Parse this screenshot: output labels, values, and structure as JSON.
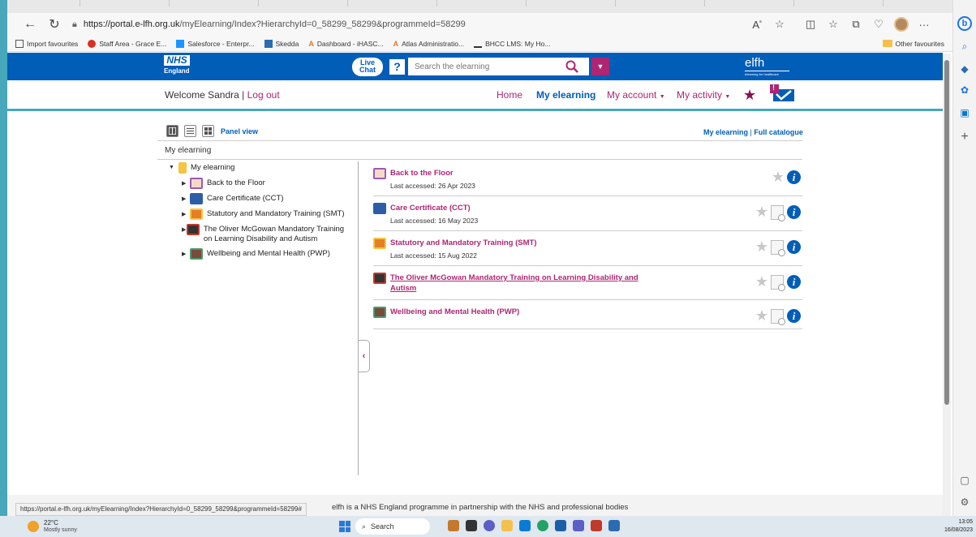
{
  "browser": {
    "url_host": "https://portal.e-lfh.org.uk",
    "url_path": "/myElearning/Index?HierarchyId=0_58299_58299&programmeId=58299",
    "favourites": [
      {
        "label": "Import favourites",
        "color": "#555555"
      },
      {
        "label": "Staff Area - Grace E...",
        "color": "#d93025"
      },
      {
        "label": "Salesforce - Enterpr...",
        "color": "#1b96ff"
      },
      {
        "label": "Skedda",
        "color": "#2b6cb0"
      },
      {
        "label": "Dashboard - iHASC...",
        "color": "#e0792b"
      },
      {
        "label": "Atlas Administratio...",
        "color": "#e0792b"
      },
      {
        "label": "BHCC LMS: My Ho...",
        "color": "#333333"
      }
    ],
    "other_favourites": "Other favourites"
  },
  "header": {
    "nhs_logo": "NHS",
    "nhs_sub": "England",
    "live_chat_1": "Live",
    "live_chat_2": "Chat",
    "help": "?",
    "search_placeholder": "Search the elearning",
    "elfh_name": "elfh",
    "elfh_tagline": "elearning for healthcare"
  },
  "nav": {
    "welcome": "Welcome Sandra",
    "separator": " | ",
    "logout": "Log out",
    "home": "Home",
    "my_elearning": "My elearning",
    "my_account": "My account",
    "my_activity": "My activity",
    "msg_badge": "!"
  },
  "content": {
    "panel_view": "Panel view",
    "link_my_elearning": "My elearning",
    "link_sep": " | ",
    "link_full_catalogue": "Full catalogue",
    "breadcrumb": "My elearning"
  },
  "tree": {
    "root": "My elearning",
    "items": [
      {
        "label": "Back to the Floor",
        "color": "#9b59b6"
      },
      {
        "label": "Care Certificate (CCT)",
        "color": "#2c5ea8"
      },
      {
        "label": "Statutory and Mandatory Training (SMT)",
        "color": "#e67e22"
      },
      {
        "label": "The Oliver McGowan Mandatory Training on Learning Disability and Autism",
        "color": "#333333"
      },
      {
        "label": "Wellbeing and Mental Health (PWP)",
        "color": "#7a4a3a"
      }
    ]
  },
  "courses": [
    {
      "title": "Back to the Floor",
      "accessed": "Last accessed: 26 Apr 2023",
      "color": "#9b59b6",
      "preview": false,
      "underline": false
    },
    {
      "title": "Care Certificate (CCT)",
      "accessed": "Last accessed: 16 May 2023",
      "color": "#2c5ea8",
      "preview": true,
      "underline": false
    },
    {
      "title": "Statutory and Mandatory Training (SMT)",
      "accessed": "Last accessed: 15 Aug 2022",
      "color": "#e67e22",
      "preview": true,
      "underline": false
    },
    {
      "title": "The Oliver McGowan Mandatory Training on Learning Disability and Autism",
      "accessed": "",
      "color": "#333333",
      "preview": true,
      "underline": true
    },
    {
      "title": "Wellbeing and Mental Health (PWP)",
      "accessed": "",
      "color": "#7a4a3a",
      "preview": true,
      "underline": false
    }
  ],
  "footer": {
    "status_url": "https://portal.e-lfh.org.uk/myElearning/Index?HierarchyId=0_58299_58299&programmeId=58299#",
    "text": "elfh is a NHS England programme in partnership with the NHS and professional bodies"
  },
  "taskbar": {
    "temperature": "22°C",
    "weather": "Mostly sunny",
    "search": "Search",
    "time": "13:05",
    "date": "16/08/2023"
  },
  "colors": {
    "nhs_blue": "#005eb8",
    "accent_pink": "#ae2573",
    "teal": "#47a7bb"
  }
}
